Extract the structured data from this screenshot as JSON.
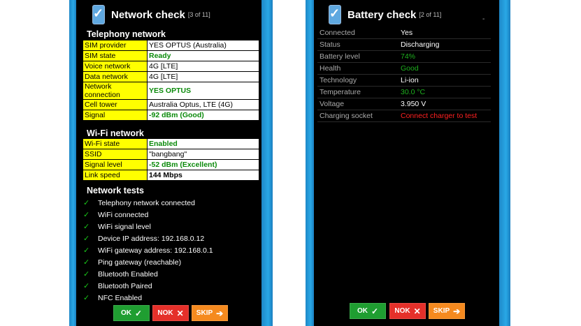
{
  "left": {
    "title": "Network check",
    "subtitle": "[3 of 11]",
    "telephony": {
      "heading": "Telephony network",
      "rows": [
        {
          "k": "SIM provider",
          "v": "YES OPTUS (Australia)",
          "style": ""
        },
        {
          "k": "SIM state",
          "v": "Ready",
          "style": "g"
        },
        {
          "k": "Voice network",
          "v": "4G [LTE]",
          "style": ""
        },
        {
          "k": "Data network",
          "v": "4G [LTE]",
          "style": ""
        },
        {
          "k": "Network connection",
          "v": "YES OPTUS",
          "style": "g"
        },
        {
          "k": "Cell tower",
          "v": "Australia Optus, LTE (4G)",
          "style": ""
        },
        {
          "k": "Signal",
          "v": "-92 dBm (Good)",
          "style": "g"
        }
      ]
    },
    "wifi": {
      "heading": "Wi-Fi network",
      "rows": [
        {
          "k": "Wi-Fi state",
          "v": "Enabled",
          "style": "g"
        },
        {
          "k": "SSID",
          "v": "\"bangbang\"",
          "style": ""
        },
        {
          "k": "Signal level",
          "v": "-52 dBm (Excellent)",
          "style": "g"
        },
        {
          "k": "Link speed",
          "v": "144 Mbps",
          "style": "b"
        }
      ]
    },
    "tests": {
      "heading": "Network tests",
      "items": [
        "Telephony network connected",
        "WiFi connected",
        "WiFi signal level",
        "Device IP address: 192.168.0.12",
        "WiFi gateway address: 192.168.0.1",
        "Ping gateway (reachable)",
        "Bluetooth Enabled",
        "Bluetooth Paired",
        "NFC Enabled"
      ]
    },
    "buttons": {
      "ok": "OK",
      "nok": "NOK",
      "skip": "SKIP"
    }
  },
  "right": {
    "title": "Battery check",
    "subtitle": "[2 of 11]",
    "rows": [
      {
        "k": "Connected",
        "v": "Yes",
        "style": ""
      },
      {
        "k": "Status",
        "v": "Discharging",
        "style": ""
      },
      {
        "k": "Battery level",
        "v": "74%",
        "style": "green"
      },
      {
        "k": "Health",
        "v": "Good",
        "style": "green"
      },
      {
        "k": "Technology",
        "v": "Li-ion",
        "style": ""
      },
      {
        "k": "Temperature",
        "v": "30.0 °C",
        "style": "green"
      },
      {
        "k": "Voltage",
        "v": "3.950 V",
        "style": ""
      },
      {
        "k": "Charging socket",
        "v": "Connect charger to test",
        "style": "red"
      }
    ],
    "buttons": {
      "ok": "OK",
      "nok": "NOK",
      "skip": "SKIP"
    }
  },
  "colors": {
    "ok": "#1f9e31",
    "nok": "#e5302a",
    "skip": "#f58a1f",
    "highlight": "#ffff00",
    "stripe": "#29a8e6"
  },
  "icons": {
    "app": "phone-check-icon",
    "tick": "checkmark-icon",
    "x": "close-icon",
    "arrow": "arrow-right-icon"
  }
}
